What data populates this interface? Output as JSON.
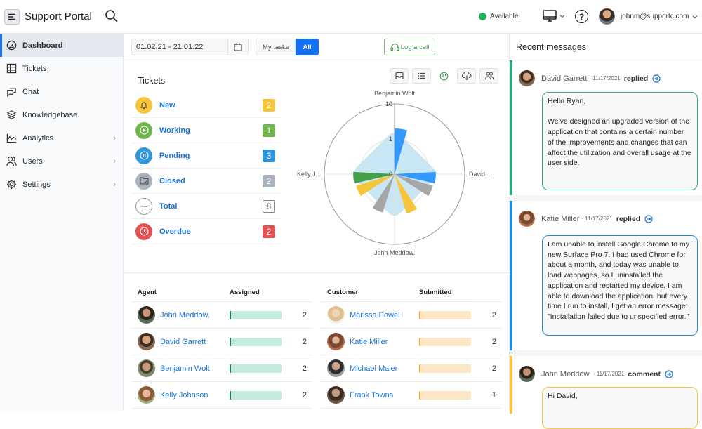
{
  "app": {
    "title": "Support Portal"
  },
  "header": {
    "status_label": "Available",
    "status_color": "#27ae60",
    "help_label": "?",
    "user_email": "johnm@supportc.com"
  },
  "sidebar": {
    "items": [
      {
        "label": "Dashboard",
        "icon": "dashboard-icon",
        "active": true
      },
      {
        "label": "Tickets",
        "icon": "table-icon"
      },
      {
        "label": "Chat",
        "icon": "chat-icon"
      },
      {
        "label": "Knowledgebase",
        "icon": "layers-icon"
      },
      {
        "label": "Analytics",
        "icon": "chart-icon",
        "has_submenu": true
      },
      {
        "label": "Users",
        "icon": "users-icon",
        "has_submenu": true
      },
      {
        "label": "Settings",
        "icon": "gear-icon",
        "has_submenu": true
      }
    ],
    "chevron": "›"
  },
  "toolbar": {
    "date_range": "01.02.21 - 21.01.22",
    "filter_my_tasks": "My tasks",
    "filter_all": "All",
    "log_call": "Log a call",
    "accent": "#1570ef"
  },
  "tickets": {
    "title": "Tickets",
    "items": [
      {
        "label": "New",
        "count": "2",
        "color": "#f8c53a",
        "icon": "bell-icon"
      },
      {
        "label": "Working",
        "count": "1",
        "color": "#6fb64f",
        "icon": "play-icon"
      },
      {
        "label": "Pending",
        "count": "3",
        "color": "#2d95dc",
        "icon": "pause-icon"
      },
      {
        "label": "Closed",
        "count": "2",
        "color": "#aab3bd",
        "icon": "folder-check-icon"
      },
      {
        "label": "Total",
        "count": "8",
        "color": "#ffffff",
        "icon": "list-icon"
      },
      {
        "label": "Overdue",
        "count": "2",
        "color": "#e65050",
        "icon": "clock-icon"
      }
    ]
  },
  "chart_tools": [
    "inbox-icon",
    "list-icon",
    "globe-icon",
    "cloud-download-icon",
    "group-icon"
  ],
  "chart_data": {
    "type": "polar-bar",
    "scale": "log",
    "rlim": [
      0,
      10
    ],
    "radial_ticks": [
      "0",
      "1",
      "10"
    ],
    "axes": [
      "Benjamin Wolt",
      "David ...",
      "John Meddow.",
      "Kelly J..."
    ],
    "background_area": {
      "name": "Total",
      "color": "#c9e6f4",
      "values": [
        2,
        2,
        2,
        2
      ]
    },
    "series": [
      {
        "name": "Pending",
        "color": "#3399ff",
        "angle_deg": 8,
        "value": 2
      },
      {
        "name": "Pending",
        "color": "#3399ff",
        "angle_deg": 95,
        "value": 1.5
      },
      {
        "name": "Closed",
        "color": "#a6a6a6",
        "angle_deg": 115,
        "value": 1.4
      },
      {
        "name": "New",
        "color": "#f8c53a",
        "angle_deg": 155,
        "value": 1.5
      },
      {
        "name": "Closed",
        "color": "#a6a6a6",
        "angle_deg": 205,
        "value": 1.4
      },
      {
        "name": "New",
        "color": "#f8c53a",
        "angle_deg": 245,
        "value": 1.4
      },
      {
        "name": "Working",
        "color": "#43a047",
        "angle_deg": 265,
        "value": 1.5
      }
    ]
  },
  "agents": {
    "headers": [
      "Agent",
      "Assigned"
    ],
    "rows": [
      {
        "name": "John Meddow.",
        "value": "2",
        "fraction": 1.0
      },
      {
        "name": "David Garrett",
        "value": "2",
        "fraction": 1.0
      },
      {
        "name": "Benjamin Wolt",
        "value": "2",
        "fraction": 1.0
      },
      {
        "name": "Kelly Johnson",
        "value": "2",
        "fraction": 1.0
      }
    ]
  },
  "customers": {
    "headers": [
      "Customer",
      "Submitted"
    ],
    "rows": [
      {
        "name": "Marissa Powel",
        "value": "2",
        "fraction": 1.0
      },
      {
        "name": "Katie Miller",
        "value": "2",
        "fraction": 1.0
      },
      {
        "name": "Michael Maier",
        "value": "2",
        "fraction": 1.0
      },
      {
        "name": "Frank Towns",
        "value": "1",
        "fraction": 1.0
      }
    ]
  },
  "messages": {
    "title": "Recent messages",
    "items": [
      {
        "author": "David Garrett",
        "date": "· 11/17/2021",
        "action": "replied",
        "color": "#2aa876",
        "body": "Hello Ryan,\n\nWe've designed an upgraded version of the application that contains a certain number of the improvements and changes that can affect the utilization and overall usage at the user side."
      },
      {
        "author": "Katie Miller",
        "date": "· 11/17/2021",
        "action": "replied",
        "color": "#1f8dd6",
        "body": "I am unable to install Google Chrome to my new Surface Pro 7. I had used Chrome for about a month, and today was unable to load webpages, so I uninstalled the application and restarted my device. I am able to download the application, but every time I run to install, I get an error message: \"Installation failed due to unspecified error.\""
      },
      {
        "author": "John Meddow.",
        "date": "· 11/17/2021",
        "action": "comment",
        "color": "#f8c53a",
        "body": "Hi David,"
      }
    ]
  }
}
